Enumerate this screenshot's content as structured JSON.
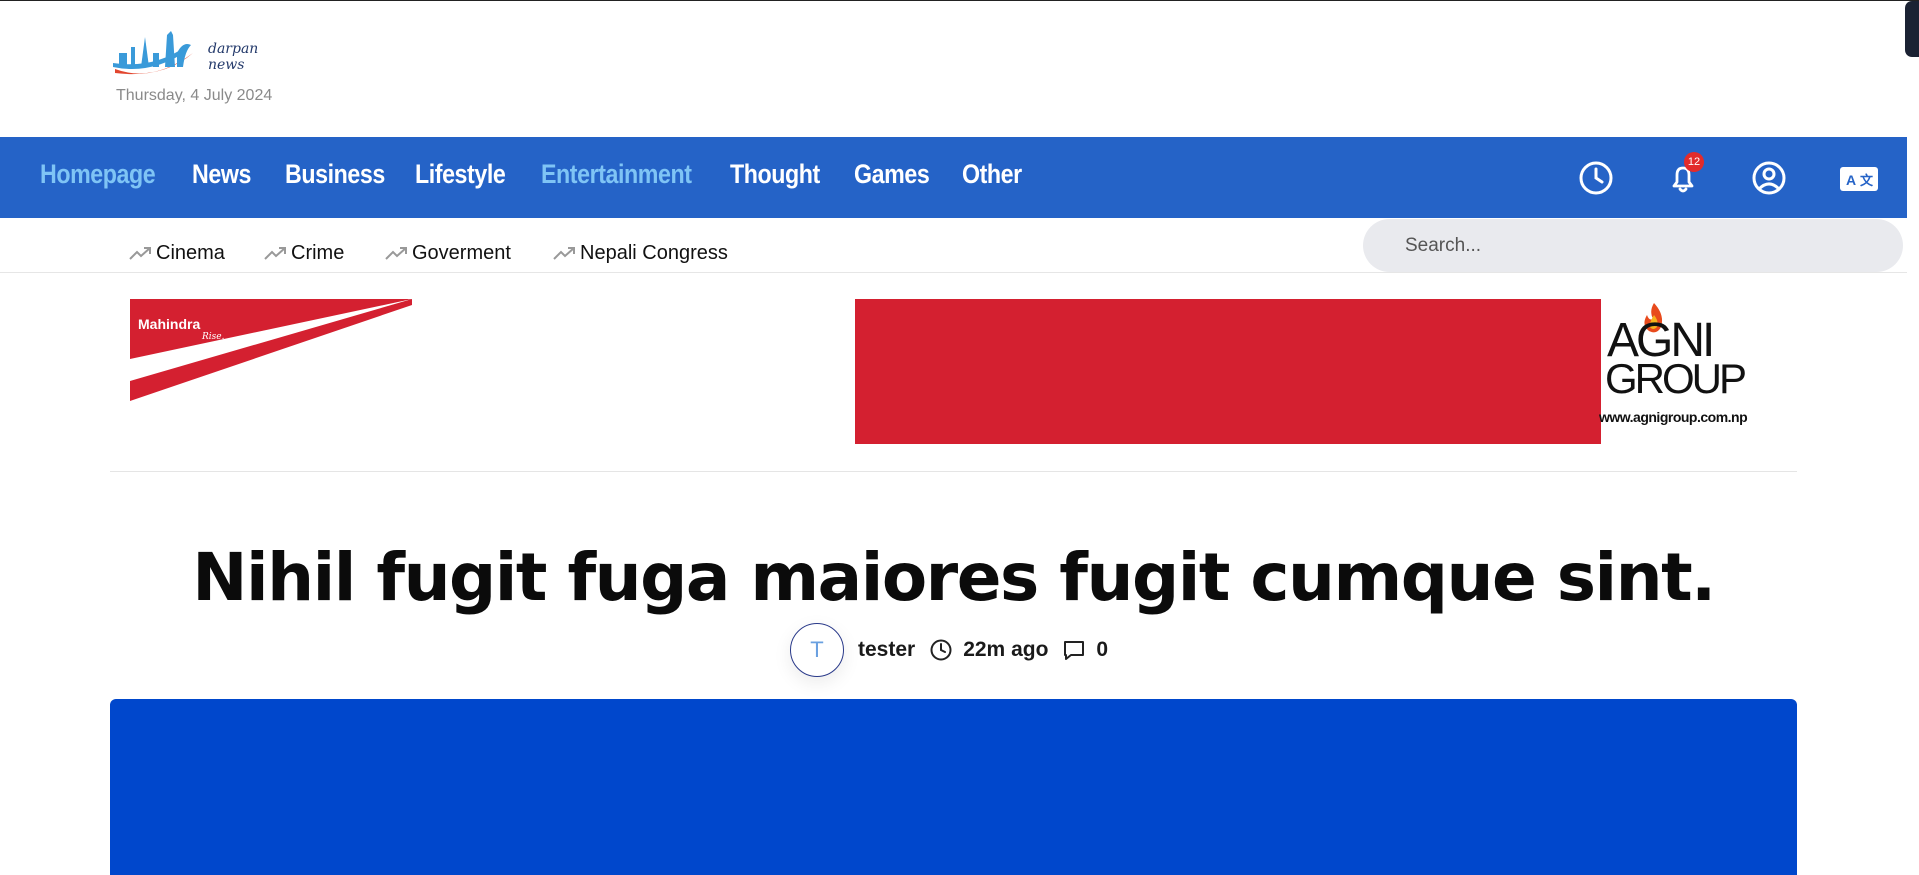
{
  "brand": {
    "name": "darpan news"
  },
  "header": {
    "date": "Thursday, 4 July 2024"
  },
  "nav": {
    "items": [
      {
        "label": "Homepage"
      },
      {
        "label": "News"
      },
      {
        "label": "Business"
      },
      {
        "label": "Lifestyle"
      },
      {
        "label": "Entertainment"
      },
      {
        "label": "Thought"
      },
      {
        "label": "Games"
      },
      {
        "label": "Other"
      }
    ],
    "notification_count": "12"
  },
  "trending": {
    "tags": [
      {
        "label": "Cinema"
      },
      {
        "label": "Crime"
      },
      {
        "label": "Goverment"
      },
      {
        "label": "Nepali Congress"
      }
    ]
  },
  "search": {
    "placeholder": "Search..."
  },
  "ads": {
    "left": {
      "brand": "Mahindra",
      "tagline": "Rise."
    },
    "right": {
      "logo_top": "AGNI",
      "logo_bottom": "GROUP",
      "url": "www.agnigroup.com.np"
    }
  },
  "article": {
    "title": "Nihil fugit fuga maiores fugit cumque sint.",
    "author_initial": "T",
    "author": "tester",
    "time_ago": "22m ago",
    "comments": "0"
  },
  "colors": {
    "nav_bg": "#2563c7",
    "nav_active": "#7fc4f5",
    "hero_bg": "#0047cc",
    "ad_red": "#d42030",
    "badge": "#e22b2b"
  }
}
